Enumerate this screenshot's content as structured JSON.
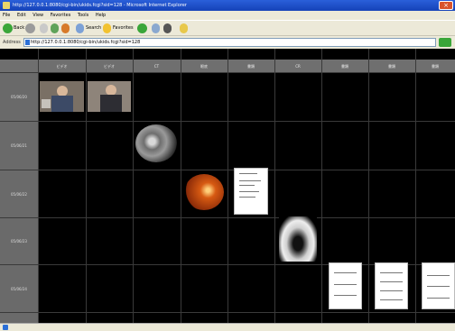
{
  "window": {
    "title": "http://127.0.0.1:8080/cgi-bin/ukids.fcgi?sid=128 - Microsoft Internet Explorer"
  },
  "menu": {
    "items": [
      "File",
      "Edit",
      "View",
      "Favorites",
      "Tools",
      "Help"
    ]
  },
  "toolbar": {
    "back_label": "Back",
    "search_label": "Search",
    "favorites_label": "Favorites"
  },
  "address": {
    "label": "Address",
    "url": "http://127.0.0.1:8080/cgi-bin/ukids.fcgi?sid=128"
  },
  "grid": {
    "column_headers": [
      "ビデオ",
      "ビデオ",
      "CT",
      "眼底",
      "書類",
      "CR",
      "書類",
      "書類",
      "書類"
    ],
    "row_headers": [
      "05/06/20",
      "05/06/21",
      "05/06/22",
      "05/06/23",
      "05/06/24"
    ]
  },
  "colors": {
    "header_gray": "#6f6f6f",
    "grid_line": "#3a3a3a",
    "background": "#000000"
  }
}
